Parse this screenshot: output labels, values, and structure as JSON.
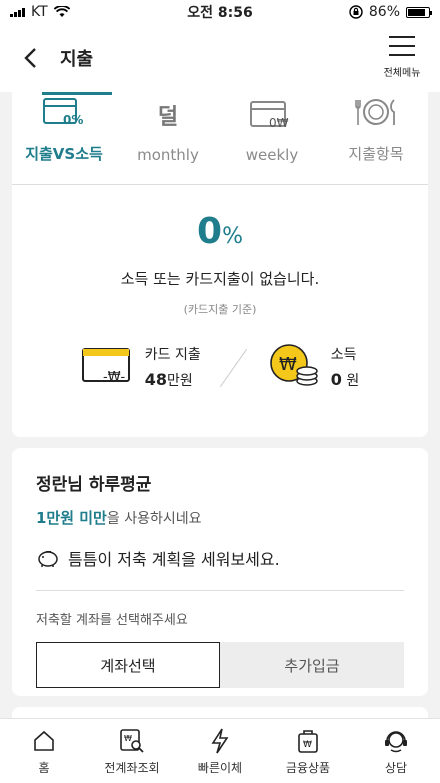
{
  "status": {
    "carrier": "KT",
    "time": "오전 8:56",
    "battery": "86%",
    "battery_level": 0.86
  },
  "header": {
    "title": "지출",
    "menu_label": "전체메뉴"
  },
  "tabs": [
    {
      "label": "지출VS소득",
      "icon": "card-percent-icon",
      "icon_text": "0%"
    },
    {
      "label": "monthly",
      "icon": "calendar-month-icon",
      "icon_text": "덜"
    },
    {
      "label": "weekly",
      "icon": "card-won-icon",
      "icon_text": "0₩"
    },
    {
      "label": "지출항목",
      "icon": "fork-plate-knife-icon"
    }
  ],
  "summary": {
    "percent": "0",
    "percent_unit": "%",
    "message": "소득 또는 카드지출이 없습니다.",
    "basis": "(카드지출 기준)",
    "card_label": "카드 지출",
    "card_amount": "48",
    "card_unit": "만원",
    "income_label": "소득",
    "income_amount": "0",
    "income_unit": "원"
  },
  "daily": {
    "title": "정란님 하루평균",
    "amount": "1만원 미만",
    "amount_suffix": "을 사용하시네요",
    "tip": "틈틈이 저축 계획을 세워보세요.",
    "choose": "저축할 계좌를 선택해주세요",
    "btn_select": "계좌선택",
    "btn_deposit": "추가입금"
  },
  "bottom_nav": [
    {
      "label": "홈",
      "icon": "home-icon"
    },
    {
      "label": "전계좌조회",
      "icon": "account-search-icon"
    },
    {
      "label": "빠른이체",
      "icon": "lightning-icon"
    },
    {
      "label": "금융상품",
      "icon": "product-bag-icon"
    },
    {
      "label": "상담",
      "icon": "headset-icon"
    }
  ],
  "colors": {
    "accent": "#1f7d8c",
    "card_yellow": "#f3c81a"
  }
}
